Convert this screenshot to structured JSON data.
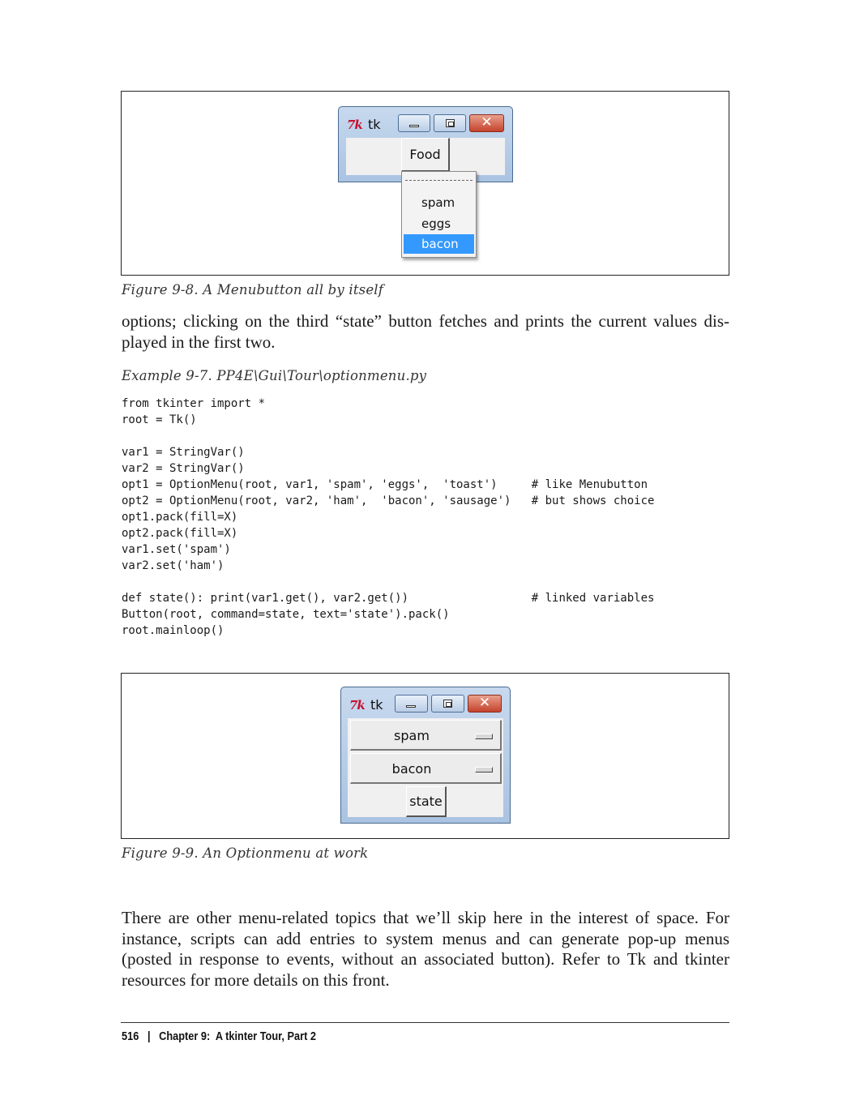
{
  "figure1": {
    "caption": "Figure 9-8. A Menubutton all by itself",
    "window": {
      "title": "tk",
      "icon": "tk-logo-icon",
      "menubutton_label": "Food",
      "menu_items": [
        "spam",
        "eggs",
        "bacon"
      ],
      "selected_item": "bacon"
    }
  },
  "body1": {
    "lines": [
      "options; clicking on the third “state” button fetches and prints the current values dis-",
      "played in the first two."
    ]
  },
  "example": {
    "caption": "Example 9-7. PP4E\\Gui\\Tour\\optionmenu.py",
    "code_lines": [
      "from tkinter import *",
      "root = Tk()",
      "",
      "var1 = StringVar()",
      "var2 = StringVar()",
      "opt1 = OptionMenu(root, var1, 'spam', 'eggs',  'toast')     # like Menubutton",
      "opt2 = OptionMenu(root, var2, 'ham',  'bacon', 'sausage')   # but shows choice",
      "opt1.pack(fill=X)",
      "opt2.pack(fill=X)",
      "var1.set('spam')",
      "var2.set('ham')",
      "",
      "def state(): print(var1.get(), var2.get())                  # linked variables",
      "Button(root, command=state, text='state').pack()",
      "root.mainloop()"
    ]
  },
  "figure2": {
    "caption": "Figure 9-9. An Optionmenu at work",
    "window": {
      "title": "tk",
      "icon": "tk-logo-icon",
      "option1_value": "spam",
      "option2_value": "bacon",
      "state_button_label": "state"
    }
  },
  "body2": {
    "lines": [
      "There are other menu-related topics that we’ll skip here in the interest of space. For",
      "instance, scripts can add entries to system menus and can generate pop-up menus",
      "(posted in response to events, without an associated button). Refer to Tk and tkinter",
      "resources for more details on this front."
    ]
  },
  "footer": {
    "page_number": "516",
    "separator": "|",
    "chapter": "Chapter 9:  A tkinter Tour, Part 2"
  }
}
